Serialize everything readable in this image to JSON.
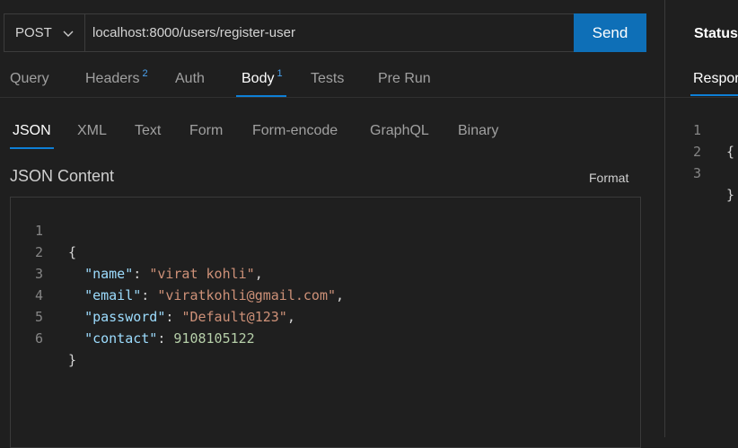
{
  "request": {
    "method": "POST",
    "url": "localhost:8000/users/register-user",
    "send_label": "Send"
  },
  "tabs": [
    {
      "label": "Query",
      "badge": ""
    },
    {
      "label": "Headers",
      "badge": "2"
    },
    {
      "label": "Auth",
      "badge": ""
    },
    {
      "label": "Body",
      "badge": "1"
    },
    {
      "label": "Tests",
      "badge": ""
    },
    {
      "label": "Pre Run",
      "badge": ""
    }
  ],
  "active_tab": "Body",
  "body_types": [
    "JSON",
    "XML",
    "Text",
    "Form",
    "Form-encode",
    "GraphQL",
    "Binary"
  ],
  "active_body_type": "JSON",
  "content_title": "JSON Content",
  "format_label": "Format",
  "editor": {
    "line_numbers": [
      "1",
      "2",
      "3",
      "4",
      "5",
      "6"
    ],
    "lines": {
      "l1": "{",
      "name_key": "\"name\"",
      "name_val": "\"virat kohli\"",
      "email_key": "\"email\"",
      "email_val": "\"viratkohli@gmail.com\"",
      "password_key": "\"password\"",
      "password_val": "\"Default@123\"",
      "contact_key": "\"contact\"",
      "contact_val": "9108105122",
      "l6": "}"
    }
  },
  "response": {
    "status_label": "Status",
    "tab_label": "Respor",
    "line_numbers": [
      "1",
      "2",
      "3"
    ],
    "lines": [
      "{",
      "",
      "}"
    ]
  },
  "colors": {
    "accent": "#0e6fb7",
    "background": "#1f1f1f",
    "json_key": "#9cdcfe",
    "json_string": "#ce9178",
    "json_number": "#b5cea8"
  }
}
